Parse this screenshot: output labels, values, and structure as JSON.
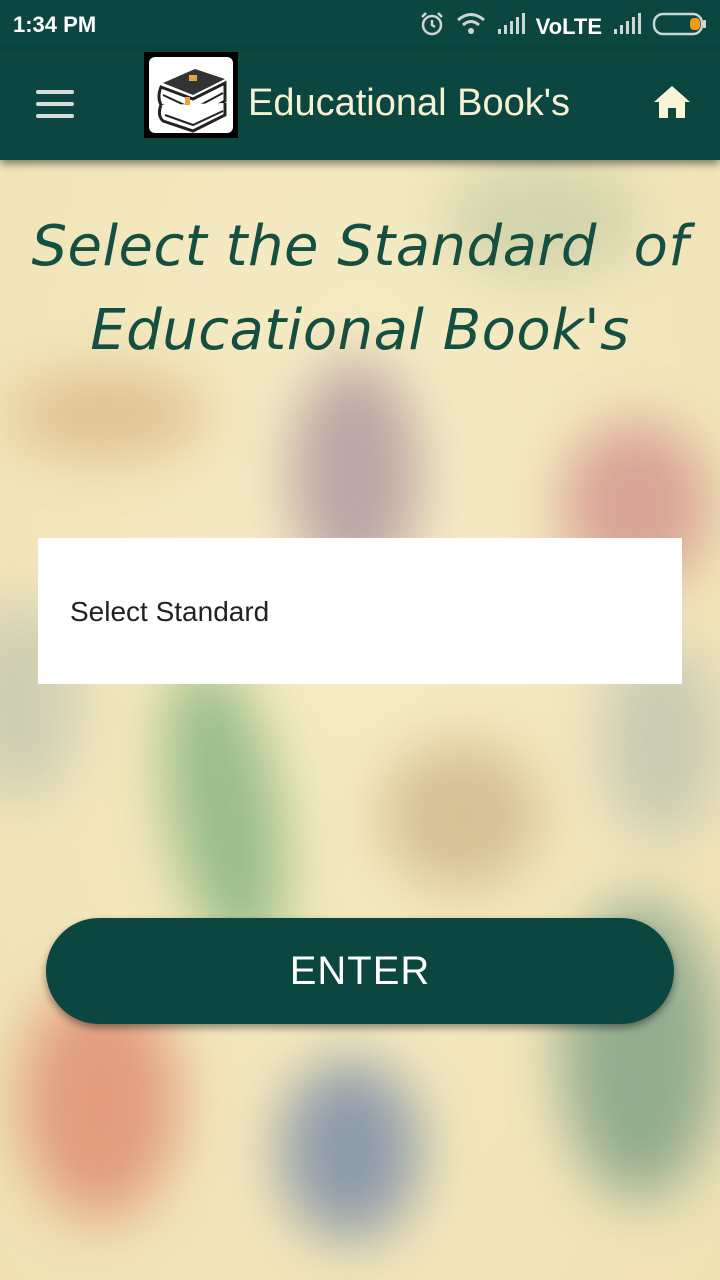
{
  "status_bar": {
    "time": "1:34 PM",
    "network": "VoLTE",
    "icons": [
      "alarm-icon",
      "wifi-icon",
      "signal-icon",
      "signal-icon",
      "battery-icon"
    ]
  },
  "app_bar": {
    "title": "Educational Book's",
    "menu_icon": "hamburger-menu-icon",
    "home_icon": "home-icon",
    "logo": "books-logo"
  },
  "main": {
    "heading_line1": "Select the Standard  of",
    "heading_line2": "Educational Book's",
    "select_placeholder": "Select Standard",
    "enter_label": "ENTER"
  },
  "colors": {
    "primary": "#0b4640",
    "heading": "#154f41",
    "background": "#f3e8bf",
    "battery_accent": "#f39c12"
  }
}
